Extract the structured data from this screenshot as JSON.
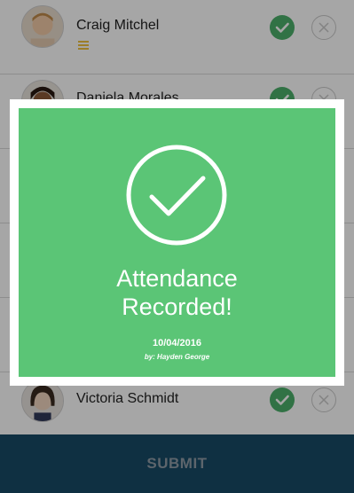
{
  "students": [
    {
      "name": "Craig Mitchel",
      "has_note": true
    },
    {
      "name": "Daniela Morales",
      "has_note": false
    },
    {
      "name": "",
      "has_note": false
    },
    {
      "name": "",
      "has_note": false
    },
    {
      "name": "",
      "has_note": false
    },
    {
      "name": "Victoria Schmidt",
      "has_note": false
    }
  ],
  "submit": {
    "label": "SUBMIT"
  },
  "modal": {
    "title_line1": "Attendance",
    "title_line2": "Recorded!",
    "date": "10/04/2016",
    "by": "by: Hayden George"
  },
  "colors": {
    "present_green": "#4caf6a",
    "modal_green": "#5bc576",
    "submit_bar": "#174a66"
  },
  "icons": {
    "present": "check-icon",
    "absent": "x-icon",
    "note": "note-lines-icon",
    "success": "big-check-circle-icon"
  }
}
